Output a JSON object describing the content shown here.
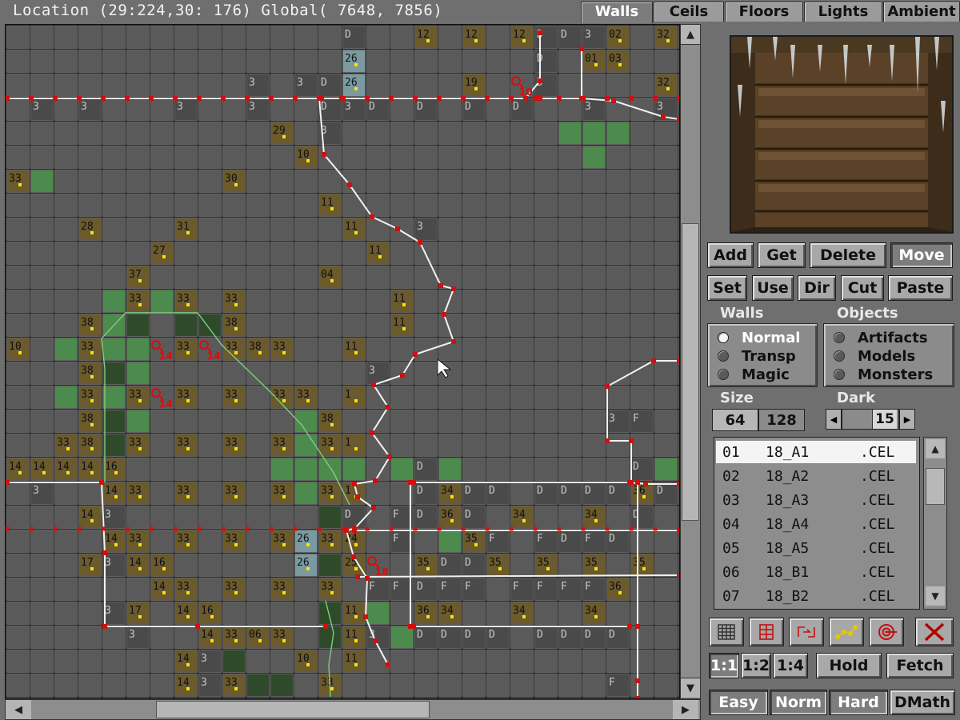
{
  "status_bar": {
    "text": "Location (29:224,30: 176) Global( 7648, 7856)"
  },
  "tabs": [
    {
      "label": "Walls",
      "active": true
    },
    {
      "label": "Ceils",
      "active": false
    },
    {
      "label": "Floors",
      "active": false
    },
    {
      "label": "Lights",
      "active": false
    },
    {
      "label": "Ambient",
      "active": false
    }
  ],
  "map": {
    "cell_labels": [
      {
        "r": 0,
        "c": 14,
        "t": "D"
      },
      {
        "r": 0,
        "c": 17,
        "t": "12"
      },
      {
        "r": 0,
        "c": 19,
        "t": "12"
      },
      {
        "r": 0,
        "c": 21,
        "t": "12"
      },
      {
        "r": 0,
        "c": 22,
        "t": "D"
      },
      {
        "r": 0,
        "c": 23,
        "t": "D"
      },
      {
        "r": 0,
        "c": 24,
        "t": "3"
      },
      {
        "r": 0,
        "c": 25,
        "t": "02"
      },
      {
        "r": 0,
        "c": 27,
        "t": "32"
      },
      {
        "r": 1,
        "c": 14,
        "t": "26"
      },
      {
        "r": 1,
        "c": 22,
        "t": "D"
      },
      {
        "r": 1,
        "c": 24,
        "t": "01"
      },
      {
        "r": 1,
        "c": 25,
        "t": "03"
      },
      {
        "r": 2,
        "c": 10,
        "t": "3"
      },
      {
        "r": 2,
        "c": 12,
        "t": "3"
      },
      {
        "r": 2,
        "c": 13,
        "t": "D"
      },
      {
        "r": 2,
        "c": 14,
        "t": "26"
      },
      {
        "r": 2,
        "c": 19,
        "t": "19"
      },
      {
        "r": 2,
        "c": 22,
        "t": "D"
      },
      {
        "r": 2,
        "c": 27,
        "t": "32"
      },
      {
        "r": 3,
        "c": 1,
        "t": "3"
      },
      {
        "r": 3,
        "c": 3,
        "t": "3"
      },
      {
        "r": 3,
        "c": 7,
        "t": "3"
      },
      {
        "r": 3,
        "c": 10,
        "t": "3"
      },
      {
        "r": 3,
        "c": 13,
        "t": "D"
      },
      {
        "r": 3,
        "c": 14,
        "t": "3"
      },
      {
        "r": 3,
        "c": 15,
        "t": "D"
      },
      {
        "r": 3,
        "c": 17,
        "t": "D"
      },
      {
        "r": 3,
        "c": 19,
        "t": "D"
      },
      {
        "r": 3,
        "c": 21,
        "t": "D"
      },
      {
        "r": 3,
        "c": 24,
        "t": "3"
      },
      {
        "r": 3,
        "c": 27,
        "t": "3"
      },
      {
        "r": 4,
        "c": 11,
        "t": "29"
      },
      {
        "r": 4,
        "c": 13,
        "t": "3"
      },
      {
        "r": 5,
        "c": 12,
        "t": "10"
      },
      {
        "r": 6,
        "c": 0,
        "t": "33"
      },
      {
        "r": 6,
        "c": 9,
        "t": "30"
      },
      {
        "r": 7,
        "c": 13,
        "t": "11"
      },
      {
        "r": 8,
        "c": 3,
        "t": "28"
      },
      {
        "r": 8,
        "c": 7,
        "t": "31"
      },
      {
        "r": 8,
        "c": 14,
        "t": "11"
      },
      {
        "r": 8,
        "c": 17,
        "t": "3"
      },
      {
        "r": 9,
        "c": 6,
        "t": "27"
      },
      {
        "r": 9,
        "c": 15,
        "t": "11"
      },
      {
        "r": 10,
        "c": 5,
        "t": "37"
      },
      {
        "r": 10,
        "c": 13,
        "t": "04"
      },
      {
        "r": 11,
        "c": 5,
        "t": "33"
      },
      {
        "r": 11,
        "c": 7,
        "t": "33"
      },
      {
        "r": 11,
        "c": 9,
        "t": "33"
      },
      {
        "r": 11,
        "c": 16,
        "t": "11"
      },
      {
        "r": 12,
        "c": 3,
        "t": "38"
      },
      {
        "r": 12,
        "c": 9,
        "t": "38"
      },
      {
        "r": 12,
        "c": 16,
        "t": "11"
      },
      {
        "r": 13,
        "c": 0,
        "t": "10"
      },
      {
        "r": 13,
        "c": 3,
        "t": "33"
      },
      {
        "r": 13,
        "c": 7,
        "t": "33"
      },
      {
        "r": 13,
        "c": 9,
        "t": "33"
      },
      {
        "r": 13,
        "c": 10,
        "t": "38"
      },
      {
        "r": 13,
        "c": 11,
        "t": "33"
      },
      {
        "r": 13,
        "c": 14,
        "t": "11"
      },
      {
        "r": 14,
        "c": 3,
        "t": "38"
      },
      {
        "r": 14,
        "c": 15,
        "t": "3"
      },
      {
        "r": 15,
        "c": 3,
        "t": "33"
      },
      {
        "r": 15,
        "c": 5,
        "t": "33"
      },
      {
        "r": 15,
        "c": 7,
        "t": "33"
      },
      {
        "r": 15,
        "c": 9,
        "t": "33"
      },
      {
        "r": 15,
        "c": 11,
        "t": "33"
      },
      {
        "r": 15,
        "c": 12,
        "t": "33"
      },
      {
        "r": 15,
        "c": 14,
        "t": "1"
      },
      {
        "r": 16,
        "c": 3,
        "t": "38"
      },
      {
        "r": 16,
        "c": 13,
        "t": "38"
      },
      {
        "r": 16,
        "c": 25,
        "t": "3"
      },
      {
        "r": 16,
        "c": 26,
        "t": "F"
      },
      {
        "r": 17,
        "c": 2,
        "t": "33"
      },
      {
        "r": 17,
        "c": 3,
        "t": "38"
      },
      {
        "r": 17,
        "c": 5,
        "t": "33"
      },
      {
        "r": 17,
        "c": 7,
        "t": "33"
      },
      {
        "r": 17,
        "c": 9,
        "t": "33"
      },
      {
        "r": 17,
        "c": 11,
        "t": "33"
      },
      {
        "r": 17,
        "c": 13,
        "t": "33"
      },
      {
        "r": 17,
        "c": 14,
        "t": "1"
      },
      {
        "r": 18,
        "c": 0,
        "t": "14"
      },
      {
        "r": 18,
        "c": 1,
        "t": "14"
      },
      {
        "r": 18,
        "c": 2,
        "t": "14"
      },
      {
        "r": 18,
        "c": 3,
        "t": "14"
      },
      {
        "r": 18,
        "c": 4,
        "t": "16"
      },
      {
        "r": 18,
        "c": 17,
        "t": "D"
      },
      {
        "r": 18,
        "c": 26,
        "t": "D"
      },
      {
        "r": 19,
        "c": 1,
        "t": "3"
      },
      {
        "r": 19,
        "c": 4,
        "t": "14"
      },
      {
        "r": 19,
        "c": 5,
        "t": "33"
      },
      {
        "r": 19,
        "c": 7,
        "t": "33"
      },
      {
        "r": 19,
        "c": 9,
        "t": "33"
      },
      {
        "r": 19,
        "c": 11,
        "t": "33"
      },
      {
        "r": 19,
        "c": 13,
        "t": "33"
      },
      {
        "r": 19,
        "c": 14,
        "t": "1"
      },
      {
        "r": 19,
        "c": 17,
        "t": "D"
      },
      {
        "r": 19,
        "c": 18,
        "t": "34"
      },
      {
        "r": 19,
        "c": 19,
        "t": "D"
      },
      {
        "r": 19,
        "c": 20,
        "t": "D"
      },
      {
        "r": 19,
        "c": 22,
        "t": "D"
      },
      {
        "r": 19,
        "c": 23,
        "t": "D"
      },
      {
        "r": 19,
        "c": 24,
        "t": "D"
      },
      {
        "r": 19,
        "c": 25,
        "t": "D"
      },
      {
        "r": 19,
        "c": 26,
        "t": "36"
      },
      {
        "r": 19,
        "c": 27,
        "t": "D"
      },
      {
        "r": 20,
        "c": 3,
        "t": "14"
      },
      {
        "r": 20,
        "c": 4,
        "t": "3"
      },
      {
        "r": 20,
        "c": 14,
        "t": "D"
      },
      {
        "r": 20,
        "c": 16,
        "t": "F"
      },
      {
        "r": 20,
        "c": 17,
        "t": "D"
      },
      {
        "r": 20,
        "c": 18,
        "t": "36"
      },
      {
        "r": 20,
        "c": 19,
        "t": "D"
      },
      {
        "r": 20,
        "c": 21,
        "t": "34"
      },
      {
        "r": 20,
        "c": 24,
        "t": "34"
      },
      {
        "r": 20,
        "c": 26,
        "t": "D"
      },
      {
        "r": 21,
        "c": 4,
        "t": "14"
      },
      {
        "r": 21,
        "c": 5,
        "t": "33"
      },
      {
        "r": 21,
        "c": 7,
        "t": "33"
      },
      {
        "r": 21,
        "c": 9,
        "t": "33"
      },
      {
        "r": 21,
        "c": 11,
        "t": "33"
      },
      {
        "r": 21,
        "c": 12,
        "t": "26"
      },
      {
        "r": 21,
        "c": 13,
        "t": "33"
      },
      {
        "r": 21,
        "c": 14,
        "t": "24"
      },
      {
        "r": 21,
        "c": 16,
        "t": "F"
      },
      {
        "r": 21,
        "c": 19,
        "t": "35"
      },
      {
        "r": 21,
        "c": 20,
        "t": "F"
      },
      {
        "r": 21,
        "c": 22,
        "t": "F"
      },
      {
        "r": 21,
        "c": 23,
        "t": "D"
      },
      {
        "r": 21,
        "c": 24,
        "t": "F"
      },
      {
        "r": 21,
        "c": 25,
        "t": "D"
      },
      {
        "r": 22,
        "c": 3,
        "t": "17"
      },
      {
        "r": 22,
        "c": 4,
        "t": "3"
      },
      {
        "r": 22,
        "c": 5,
        "t": "14"
      },
      {
        "r": 22,
        "c": 6,
        "t": "16"
      },
      {
        "r": 22,
        "c": 12,
        "t": "26"
      },
      {
        "r": 22,
        "c": 14,
        "t": "25"
      },
      {
        "r": 22,
        "c": 17,
        "t": "35"
      },
      {
        "r": 22,
        "c": 18,
        "t": "D"
      },
      {
        "r": 22,
        "c": 19,
        "t": "D"
      },
      {
        "r": 22,
        "c": 20,
        "t": "35"
      },
      {
        "r": 22,
        "c": 22,
        "t": "35"
      },
      {
        "r": 22,
        "c": 24,
        "t": "35"
      },
      {
        "r": 22,
        "c": 26,
        "t": "35"
      },
      {
        "r": 23,
        "c": 6,
        "t": "14"
      },
      {
        "r": 23,
        "c": 7,
        "t": "33"
      },
      {
        "r": 23,
        "c": 9,
        "t": "33"
      },
      {
        "r": 23,
        "c": 11,
        "t": "33"
      },
      {
        "r": 23,
        "c": 13,
        "t": "33"
      },
      {
        "r": 23,
        "c": 15,
        "t": "F"
      },
      {
        "r": 23,
        "c": 16,
        "t": "F"
      },
      {
        "r": 23,
        "c": 17,
        "t": "D"
      },
      {
        "r": 23,
        "c": 18,
        "t": "F"
      },
      {
        "r": 23,
        "c": 19,
        "t": "F"
      },
      {
        "r": 23,
        "c": 21,
        "t": "F"
      },
      {
        "r": 23,
        "c": 22,
        "t": "F"
      },
      {
        "r": 23,
        "c": 23,
        "t": "F"
      },
      {
        "r": 23,
        "c": 24,
        "t": "F"
      },
      {
        "r": 23,
        "c": 25,
        "t": "36"
      },
      {
        "r": 24,
        "c": 4,
        "t": "3"
      },
      {
        "r": 24,
        "c": 5,
        "t": "17"
      },
      {
        "r": 24,
        "c": 7,
        "t": "14"
      },
      {
        "r": 24,
        "c": 8,
        "t": "16"
      },
      {
        "r": 24,
        "c": 14,
        "t": "11"
      },
      {
        "r": 24,
        "c": 17,
        "t": "36"
      },
      {
        "r": 24,
        "c": 18,
        "t": "34"
      },
      {
        "r": 24,
        "c": 21,
        "t": "34"
      },
      {
        "r": 24,
        "c": 24,
        "t": "34"
      },
      {
        "r": 25,
        "c": 5,
        "t": "3"
      },
      {
        "r": 25,
        "c": 8,
        "t": "14"
      },
      {
        "r": 25,
        "c": 9,
        "t": "33"
      },
      {
        "r": 25,
        "c": 10,
        "t": "06"
      },
      {
        "r": 25,
        "c": 11,
        "t": "33"
      },
      {
        "r": 25,
        "c": 14,
        "t": "11"
      },
      {
        "r": 25,
        "c": 15,
        "t": "3"
      },
      {
        "r": 25,
        "c": 17,
        "t": "D"
      },
      {
        "r": 25,
        "c": 18,
        "t": "D"
      },
      {
        "r": 25,
        "c": 19,
        "t": "D"
      },
      {
        "r": 25,
        "c": 20,
        "t": "D"
      },
      {
        "r": 25,
        "c": 22,
        "t": "D"
      },
      {
        "r": 25,
        "c": 23,
        "t": "D"
      },
      {
        "r": 25,
        "c": 24,
        "t": "D"
      },
      {
        "r": 25,
        "c": 25,
        "t": "D"
      },
      {
        "r": 26,
        "c": 7,
        "t": "14"
      },
      {
        "r": 26,
        "c": 8,
        "t": "3"
      },
      {
        "r": 26,
        "c": 12,
        "t": "10"
      },
      {
        "r": 26,
        "c": 14,
        "t": "11"
      },
      {
        "r": 27,
        "c": 7,
        "t": "14"
      },
      {
        "r": 27,
        "c": 8,
        "t": "3"
      },
      {
        "r": 27,
        "c": 9,
        "t": "33"
      },
      {
        "r": 27,
        "c": 13,
        "t": "33"
      },
      {
        "r": 27,
        "c": 25,
        "t": "F"
      }
    ],
    "object_markers": [
      {
        "r": 2,
        "c": 21,
        "t": "10"
      },
      {
        "r": 13,
        "c": 6,
        "t": "14"
      },
      {
        "r": 13,
        "c": 8,
        "t": "14"
      },
      {
        "r": 15,
        "c": 6,
        "t": "14"
      },
      {
        "r": 22,
        "c": 15,
        "t": "18"
      }
    ]
  },
  "preview": {
    "alt": "wall texture preview"
  },
  "edit_buttons": {
    "row1": [
      "Add",
      "Get",
      "Delete",
      "Move"
    ],
    "row2": [
      "Set",
      "Use",
      "Dir",
      "Cut",
      "Paste"
    ]
  },
  "walls_group": {
    "label": "Walls",
    "options": [
      "Normal",
      "Transp",
      "Magic"
    ],
    "selected": "Normal"
  },
  "objects_group": {
    "label": "Objects",
    "options": [
      "Artifacts",
      "Models",
      "Monsters"
    ]
  },
  "size": {
    "label": "Size",
    "options": [
      "64",
      "128"
    ],
    "selected": "64"
  },
  "dark": {
    "label": "Dark",
    "value": "15"
  },
  "files": [
    {
      "num": "01",
      "name": "18_A1",
      "ext": ".CEL",
      "selected": true
    },
    {
      "num": "02",
      "name": "18_A2",
      "ext": ".CEL"
    },
    {
      "num": "03",
      "name": "18_A3",
      "ext": ".CEL"
    },
    {
      "num": "04",
      "name": "18_A4",
      "ext": ".CEL"
    },
    {
      "num": "05",
      "name": "18_A5",
      "ext": ".CEL"
    },
    {
      "num": "06",
      "name": "18_B1",
      "ext": ".CEL"
    },
    {
      "num": "07",
      "name": "18_B2",
      "ext": ".CEL"
    }
  ],
  "tool_icons": [
    "grid-icon",
    "floor-icon",
    "link-icon",
    "path-icon",
    "target-icon",
    "delete-x-icon"
  ],
  "zoom_buttons": [
    "1:1",
    "1:2",
    "1:4"
  ],
  "hold_label": "Hold",
  "fetch_label": "Fetch",
  "difficulty_buttons": [
    "Easy",
    "Norm",
    "Hard",
    "DMath"
  ],
  "colors": {
    "grid_bg": "#747474",
    "tile": "#5a5a5a",
    "tile_brown": "#6a5a2e",
    "tile_green": "#4d8a4d",
    "tile_dkgreen": "#2f4a2a",
    "wall_line": "#f2f2f2",
    "vertex": "#d01010",
    "marker": "#ffe000"
  }
}
